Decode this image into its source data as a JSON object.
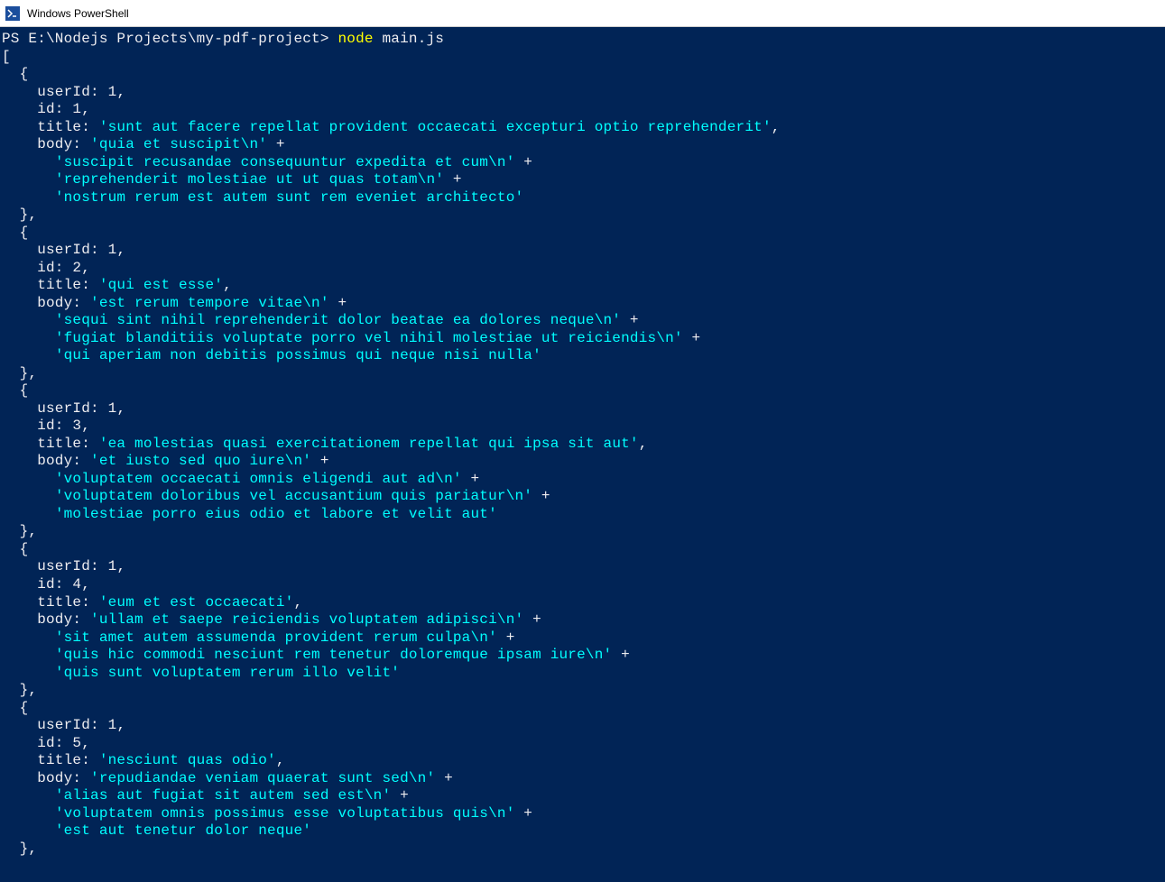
{
  "titlebar": {
    "title": "Windows PowerShell"
  },
  "prompt": {
    "path": "PS E:\\Nodejs Projects\\my-pdf-project> ",
    "cmd_node": "node",
    "cmd_arg": " main.js"
  },
  "output": {
    "open_bracket": "[",
    "records": [
      {
        "userId_label": "    userId: ",
        "userId_val": "1",
        "id_label": "    id: ",
        "id_val": "1",
        "title_label": "    title: ",
        "title_val": "'sunt aut facere repellat provident occaecati excepturi optio reprehenderit'",
        "body_label": "    body: ",
        "body_parts": [
          "'quia et suscipit\\n'",
          "'suscipit recusandae consequuntur expedita et cum\\n'",
          "'reprehenderit molestiae ut ut quas totam\\n'",
          "'nostrum rerum est autem sunt rem eveniet architecto'"
        ]
      },
      {
        "userId_label": "    userId: ",
        "userId_val": "1",
        "id_label": "    id: ",
        "id_val": "2",
        "title_label": "    title: ",
        "title_val": "'qui est esse'",
        "body_label": "    body: ",
        "body_parts": [
          "'est rerum tempore vitae\\n'",
          "'sequi sint nihil reprehenderit dolor beatae ea dolores neque\\n'",
          "'fugiat blanditiis voluptate porro vel nihil molestiae ut reiciendis\\n'",
          "'qui aperiam non debitis possimus qui neque nisi nulla'"
        ]
      },
      {
        "userId_label": "    userId: ",
        "userId_val": "1",
        "id_label": "    id: ",
        "id_val": "3",
        "title_label": "    title: ",
        "title_val": "'ea molestias quasi exercitationem repellat qui ipsa sit aut'",
        "body_label": "    body: ",
        "body_parts": [
          "'et iusto sed quo iure\\n'",
          "'voluptatem occaecati omnis eligendi aut ad\\n'",
          "'voluptatem doloribus vel accusantium quis pariatur\\n'",
          "'molestiae porro eius odio et labore et velit aut'"
        ]
      },
      {
        "userId_label": "    userId: ",
        "userId_val": "1",
        "id_label": "    id: ",
        "id_val": "4",
        "title_label": "    title: ",
        "title_val": "'eum et est occaecati'",
        "body_label": "    body: ",
        "body_parts": [
          "'ullam et saepe reiciendis voluptatem adipisci\\n'",
          "'sit amet autem assumenda provident rerum culpa\\n'",
          "'quis hic commodi nesciunt rem tenetur doloremque ipsam iure\\n'",
          "'quis sunt voluptatem rerum illo velit'"
        ]
      },
      {
        "userId_label": "    userId: ",
        "userId_val": "1",
        "id_label": "    id: ",
        "id_val": "5",
        "title_label": "    title: ",
        "title_val": "'nesciunt quas odio'",
        "body_label": "    body: ",
        "body_parts": [
          "'repudiandae veniam quaerat sunt sed\\n'",
          "'alias aut fugiat sit autem sed est\\n'",
          "'voluptatem omnis possimus esse voluptatibus quis\\n'",
          "'est aut tenetur dolor neque'"
        ]
      }
    ],
    "open_brace": "  {",
    "close_brace_comma": "  },",
    "comma": ",",
    "plus": " +",
    "indent_cont": "      "
  }
}
